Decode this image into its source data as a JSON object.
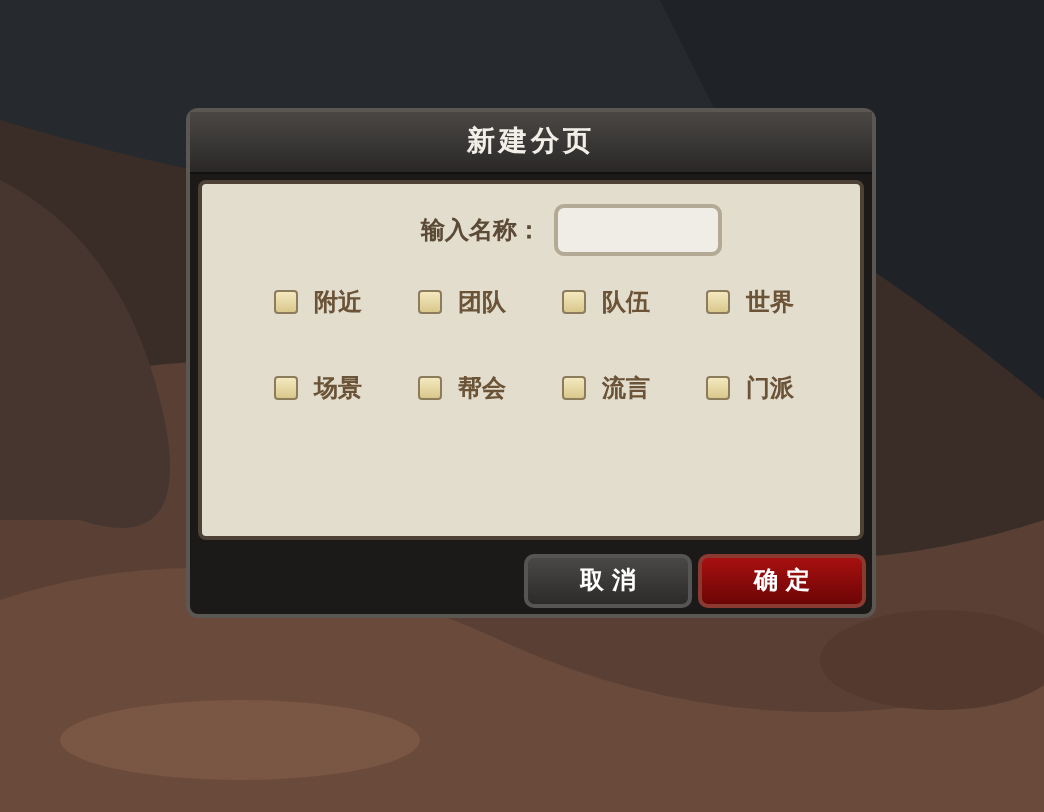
{
  "dialog": {
    "title": "新建分页",
    "name_label": "输入名称：",
    "channels": [
      {
        "label": "附近",
        "checked": false
      },
      {
        "label": "团队",
        "checked": false
      },
      {
        "label": "队伍",
        "checked": false
      },
      {
        "label": "世界",
        "checked": false
      },
      {
        "label": "场景",
        "checked": false
      },
      {
        "label": "帮会",
        "checked": false
      },
      {
        "label": "流言",
        "checked": false
      },
      {
        "label": "门派",
        "checked": false
      }
    ],
    "buttons": [
      {
        "label": "取 消",
        "kind": "secondary"
      },
      {
        "label": "确 定",
        "kind": "primary"
      }
    ]
  }
}
